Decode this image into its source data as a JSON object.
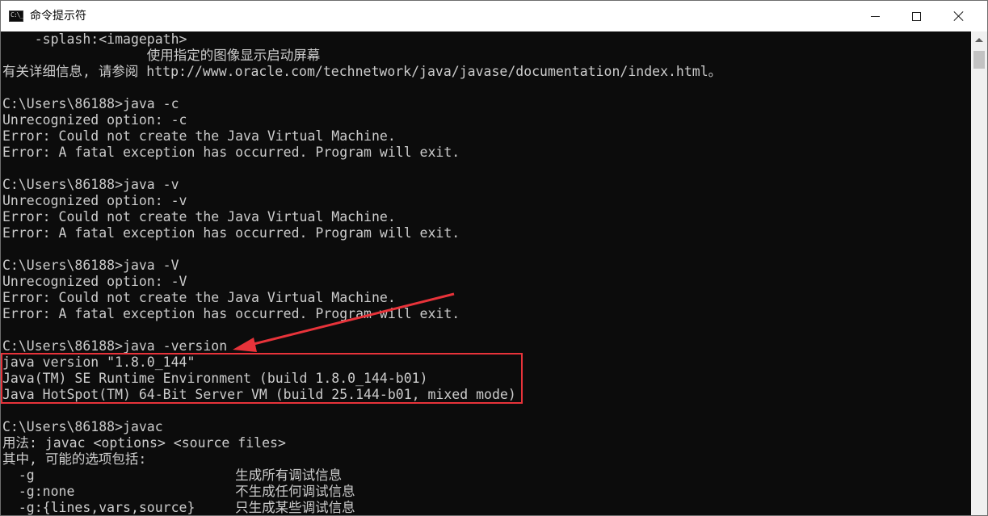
{
  "window": {
    "title": "命令提示符",
    "icon_label": "C:\\_",
    "controls": {
      "minimize": "minimize-icon",
      "maximize": "maximize-icon",
      "close": "close-icon"
    }
  },
  "console": {
    "lines": [
      "    -splash:<imagepath>",
      "                  使用指定的图像显示启动屏幕",
      "有关详细信息, 请参阅 http://www.oracle.com/technetwork/java/javase/documentation/index.html。",
      "",
      "C:\\Users\\86188>java -c",
      "Unrecognized option: -c",
      "Error: Could not create the Java Virtual Machine.",
      "Error: A fatal exception has occurred. Program will exit.",
      "",
      "C:\\Users\\86188>java -v",
      "Unrecognized option: -v",
      "Error: Could not create the Java Virtual Machine.",
      "Error: A fatal exception has occurred. Program will exit.",
      "",
      "C:\\Users\\86188>java -V",
      "Unrecognized option: -V",
      "Error: Could not create the Java Virtual Machine.",
      "Error: A fatal exception has occurred. Program will exit.",
      "",
      "C:\\Users\\86188>java -version",
      "java version \"1.8.0_144\"",
      "Java(TM) SE Runtime Environment (build 1.8.0_144-b01)",
      "Java HotSpot(TM) 64-Bit Server VM (build 25.144-b01, mixed mode)",
      "",
      "C:\\Users\\86188>javac",
      "用法: javac <options> <source files>",
      "其中, 可能的选项包括:",
      "  -g                         生成所有调试信息",
      "  -g:none                    不生成任何调试信息",
      "  -g:{lines,vars,source}     只生成某些调试信息"
    ]
  },
  "annotation": {
    "color": "#e8333a"
  },
  "colors": {
    "console_bg": "#0c0c0c",
    "console_text": "#cccccc",
    "titlebar_bg": "#ffffff"
  }
}
